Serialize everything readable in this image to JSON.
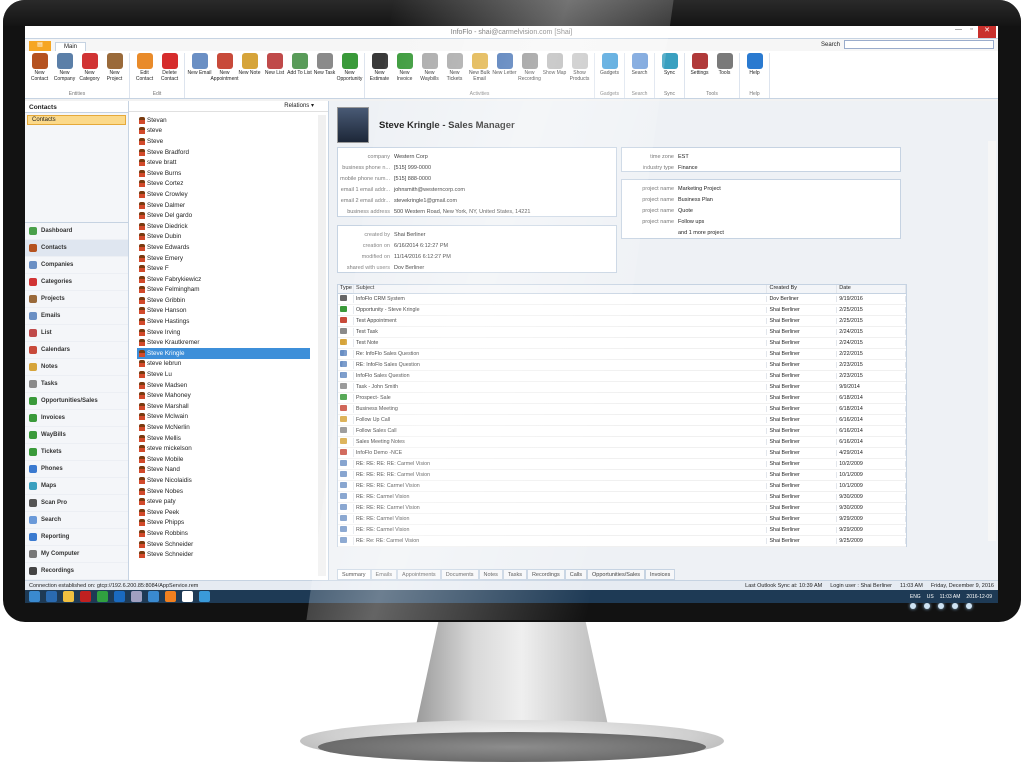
{
  "window": {
    "title": "InfoFlo - shai@carmelvision.com [Shai]",
    "ribbon_tab": "Main",
    "search_label": "Search"
  },
  "ribbon": {
    "groups": [
      {
        "name": "Entities",
        "buttons": [
          {
            "label": "New Contact",
            "color": "#b5521f"
          },
          {
            "label": "New Company",
            "color": "#5b7fa8"
          },
          {
            "label": "New Category",
            "color": "#d13434"
          },
          {
            "label": "New Project",
            "color": "#9a6a3a"
          }
        ]
      },
      {
        "name": "Edit",
        "buttons": [
          {
            "label": "Edit Contact",
            "color": "#e98b2a"
          },
          {
            "label": "Delete Contact",
            "color": "#d62d2d"
          }
        ]
      },
      {
        "name": "",
        "buttons": [
          {
            "label": "New Email",
            "color": "#6a8fc4"
          },
          {
            "label": "New Appointment",
            "color": "#c84a3a"
          },
          {
            "label": "New Note",
            "color": "#d6a43a"
          },
          {
            "label": "New List",
            "color": "#c04a4a"
          },
          {
            "label": "Add To List",
            "color": "#5a9c5a"
          },
          {
            "label": "New Task",
            "color": "#8a8a8a"
          },
          {
            "label": "New Opportunity",
            "color": "#3a9a3a"
          }
        ]
      },
      {
        "name": "Activities",
        "buttons": [
          {
            "label": "New Estimate",
            "color": "#3a3a3a"
          },
          {
            "label": "New Invoice",
            "color": "#3a9a3a"
          },
          {
            "label": "New Waybills",
            "color": "#a8a8a8"
          },
          {
            "label": "New Tickets",
            "color": "#a8a8a8"
          },
          {
            "label": "New Bulk Email",
            "color": "#e0b040"
          },
          {
            "label": "New Letter",
            "color": "#3a6ab0"
          },
          {
            "label": "New Recording",
            "color": "#8a8a8a"
          },
          {
            "label": "Show Map",
            "color": "#b0b0b0"
          },
          {
            "label": "Show Products",
            "color": "#c0c0c0"
          }
        ]
      },
      {
        "name": "Gadgets",
        "buttons": [
          {
            "label": "Gadgets",
            "color": "#3a9ad9"
          }
        ]
      },
      {
        "name": "Search",
        "buttons": [
          {
            "label": "Search",
            "color": "#6a9ad9"
          }
        ]
      },
      {
        "name": "Sync",
        "buttons": [
          {
            "label": "Sync",
            "color": "#3aa0c0"
          }
        ]
      },
      {
        "name": "Tools",
        "buttons": [
          {
            "label": "Settings",
            "color": "#b03a3a"
          },
          {
            "label": "Tools",
            "color": "#7a7a7a"
          }
        ]
      },
      {
        "name": "Help",
        "buttons": [
          {
            "label": "Help",
            "color": "#2a7ad0"
          }
        ]
      }
    ],
    "settings_group": "Settings"
  },
  "nav": {
    "header": "Contacts",
    "selected": "Contacts",
    "items": [
      {
        "label": "Dashboard",
        "color": "#4aa04a"
      },
      {
        "label": "Contacts",
        "color": "#b5521f"
      },
      {
        "label": "Companies",
        "color": "#6a8fc4"
      },
      {
        "label": "Categories",
        "color": "#d13434"
      },
      {
        "label": "Projects",
        "color": "#9a6a3a"
      },
      {
        "label": "Emails",
        "color": "#6a8fc4"
      },
      {
        "label": "List",
        "color": "#c04a4a"
      },
      {
        "label": "Calendars",
        "color": "#c84a3a"
      },
      {
        "label": "Notes",
        "color": "#d6a43a"
      },
      {
        "label": "Tasks",
        "color": "#8a8a8a"
      },
      {
        "label": "Opportunities/Sales",
        "color": "#3a9a3a"
      },
      {
        "label": "Invoices",
        "color": "#3a9a3a"
      },
      {
        "label": "WayBills",
        "color": "#3a9a3a"
      },
      {
        "label": "Tickets",
        "color": "#3a9a3a"
      },
      {
        "label": "Phones",
        "color": "#3a7ad0"
      },
      {
        "label": "Maps",
        "color": "#3aa0c0"
      },
      {
        "label": "Scan Pro",
        "color": "#555555"
      },
      {
        "label": "Search",
        "color": "#6a9ad9"
      },
      {
        "label": "Reporting",
        "color": "#3a7ad0"
      },
      {
        "label": "My Computer",
        "color": "#777777"
      },
      {
        "label": "Recordings",
        "color": "#444444"
      }
    ]
  },
  "contacts": {
    "relations_label": "Relations",
    "items": [
      "Stevan",
      "steve",
      "Steve",
      "Steve Bradford",
      "steve bratt",
      "Steve Burns",
      "Steve Cortez",
      "Steve Crowley",
      "Steve Dalmer",
      "Steve Del gardo",
      "Steve Diedrick",
      "Steve Dubin",
      "Steve Edwards",
      "Steve Emery",
      "Steve F",
      "Steve Fabrykiewicz",
      "Steve Felmingham",
      "Steve Gribbin",
      "Steve Hanson",
      "Steve Hastings",
      "Steve Irving",
      "Steve Krautkremer",
      "Steve Kringle",
      "steve lebrun",
      "Steve Lu",
      "Steve Madsen",
      "Steve Mahoney",
      "Steve Marshall",
      "Steve McIwain",
      "Steve McNerlin",
      "Steve Mellis",
      "steve mickelson",
      "Steve Mobile",
      "Steve Nand",
      "Steve Nicolaidis",
      "Steve Nobes",
      "steve paty",
      "Steve Peek",
      "Steve Phipps",
      "Steve Robbins",
      "Steve Schneider",
      "Steve Schneider"
    ],
    "selected_index": 22
  },
  "contact": {
    "title": "Steve Kringle - Sales Manager",
    "fields": [
      {
        "label": "company",
        "value": "Western Corp"
      },
      {
        "label": "business phone n...",
        "value": "[515] 999-0000"
      },
      {
        "label": "mobile phone num...",
        "value": "[515] 888-0000"
      },
      {
        "label": "email 1 email addr...",
        "value": "johnsmith@westerncorp.com"
      },
      {
        "label": "email 2 email addr...",
        "value": "stevekringle1@gmail.com"
      },
      {
        "label": "business address",
        "value": "500 Western Road, New York, NY, United States, 14221"
      }
    ],
    "timezone_fields": [
      {
        "label": "time zone",
        "value": "EST"
      },
      {
        "label": "industry type",
        "value": "Finance"
      }
    ],
    "project_fields": [
      {
        "label": "project name",
        "value": "Marketing Project"
      },
      {
        "label": "project name",
        "value": "Business Plan"
      },
      {
        "label": "project name",
        "value": "Quote"
      },
      {
        "label": "project name",
        "value": "Follow ups"
      },
      {
        "label": "",
        "value": "and 1 more project"
      }
    ],
    "meta_fields": [
      {
        "label": "created by",
        "value": "Shai Berliner"
      },
      {
        "label": "creation on",
        "value": "6/16/2014 6:12:27 PM"
      },
      {
        "label": "modified on",
        "value": "11/14/2016 6:12:27 PM"
      },
      {
        "label": "shared with users",
        "value": "Dov Berliner"
      }
    ]
  },
  "activity_grid": {
    "headers": [
      "Type",
      "Subject",
      "Created By",
      "Date"
    ],
    "rows": [
      {
        "icon": "#666666",
        "subject": "InfoFlo CRM System",
        "by": "Dov Berliner",
        "date": "9/19/2016"
      },
      {
        "icon": "#3a9a3a",
        "subject": "Opportunity - Steve Kringle",
        "by": "Shai Berliner",
        "date": "2/25/2015"
      },
      {
        "icon": "#c84a3a",
        "subject": "Test Appointment",
        "by": "Shai Berliner",
        "date": "2/25/2015"
      },
      {
        "icon": "#8a8a8a",
        "subject": "Test Task",
        "by": "Shai Berliner",
        "date": "2/24/2015"
      },
      {
        "icon": "#d6a43a",
        "subject": "Test Note",
        "by": "Shai Berliner",
        "date": "2/24/2015"
      },
      {
        "icon": "#6a8fc4",
        "subject": "Re: InfoFlo Sales Question",
        "by": "Shai Berliner",
        "date": "2/22/2015"
      },
      {
        "icon": "#6a8fc4",
        "subject": "RE: InfoFlo Sales Question",
        "by": "Shai Berliner",
        "date": "2/23/2015"
      },
      {
        "icon": "#6a8fc4",
        "subject": "InfoFlo Sales Question",
        "by": "Shai Berliner",
        "date": "2/23/2015"
      },
      {
        "icon": "#8a8a8a",
        "subject": "Task - John Smith",
        "by": "Shai Berliner",
        "date": "9/9/2014"
      },
      {
        "icon": "#3a9a3a",
        "subject": "Prospect- Sale",
        "by": "Shai Berliner",
        "date": "6/18/2014"
      },
      {
        "icon": "#c84a3a",
        "subject": "Business Meeting",
        "by": "Shai Berliner",
        "date": "6/18/2014"
      },
      {
        "icon": "#d6a43a",
        "subject": "Follow Up Call",
        "by": "Shai Berliner",
        "date": "6/16/2014"
      },
      {
        "icon": "#8a8a8a",
        "subject": "Follow Sales Call",
        "by": "Shai Berliner",
        "date": "6/16/2014"
      },
      {
        "icon": "#d6a43a",
        "subject": "Sales Meeting Notes",
        "by": "Shai Berliner",
        "date": "6/16/2014"
      },
      {
        "icon": "#c84a3a",
        "subject": "InfoFlo Demo -NCE",
        "by": "Shai Berliner",
        "date": "4/29/2014"
      },
      {
        "icon": "#6a8fc4",
        "subject": "RE: RE: RE: RE: Carmel Vision",
        "by": "Shai Berliner",
        "date": "10/2/2009"
      },
      {
        "icon": "#6a8fc4",
        "subject": "RE: RE: RE: RE: Carmel Vision",
        "by": "Shai Berliner",
        "date": "10/1/2009"
      },
      {
        "icon": "#6a8fc4",
        "subject": "RE: RE: RE: Carmel Vision",
        "by": "Shai Berliner",
        "date": "10/1/2009"
      },
      {
        "icon": "#6a8fc4",
        "subject": "RE: RE: Carmel Vision",
        "by": "Shai Berliner",
        "date": "9/30/2009"
      },
      {
        "icon": "#6a8fc4",
        "subject": "RE: RE: RE: Carmel Vision",
        "by": "Shai Berliner",
        "date": "9/30/2009"
      },
      {
        "icon": "#6a8fc4",
        "subject": "RE: RE: Carmel Vision",
        "by": "Shai Berliner",
        "date": "9/29/2009"
      },
      {
        "icon": "#6a8fc4",
        "subject": "RE: RE: Carmel Vision",
        "by": "Shai Berliner",
        "date": "9/29/2009"
      },
      {
        "icon": "#6a8fc4",
        "subject": "RE: Re: RE: Carmel Vision",
        "by": "Shai Berliner",
        "date": "9/25/2009"
      }
    ]
  },
  "bottom_tabs": [
    "Summary",
    "Emails",
    "Appointments",
    "Documents",
    "Notes",
    "Tasks",
    "Recordings",
    "Calls",
    "Opportunities/Sales",
    "Invoices"
  ],
  "status": {
    "left": "Connection established on: gtcp://192.6.200.85:8084/AppService.rem",
    "sync": "Last Outlook Sync at: 10:39 AM",
    "login": "Login user : Shai Berliner",
    "time": "11:03 AM",
    "date": "Friday, December 9, 2016"
  },
  "taskbar": {
    "apps": [
      {
        "color": "#2a6ab0"
      },
      {
        "color": "#f0c040"
      },
      {
        "color": "#c02020"
      },
      {
        "color": "#30a040"
      },
      {
        "color": "#1a6ac0"
      },
      {
        "color": "#a0a0c0"
      },
      {
        "color": "#3a8ad0"
      },
      {
        "color": "#f08020"
      },
      {
        "color": "#ffffff"
      },
      {
        "color": "#3a9ad9"
      }
    ],
    "lang": "ENG",
    "region": "US",
    "clock": "11:03 AM",
    "clock_date": "2016-12-09"
  }
}
